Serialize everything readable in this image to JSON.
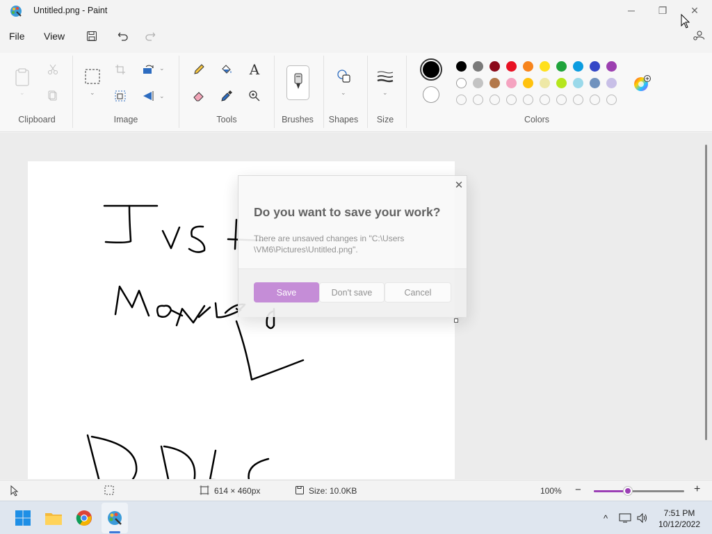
{
  "window": {
    "title": "Untitled.png - Paint",
    "minimize_glyph": "─",
    "maximize_glyph": "❐",
    "close_glyph": "✕"
  },
  "menu": {
    "file": "File",
    "view": "View"
  },
  "ribbon": {
    "groups": {
      "clipboard": "Clipboard",
      "image": "Image",
      "tools": "Tools",
      "brushes": "Brushes",
      "shapes": "Shapes",
      "size": "Size",
      "colors": "Colors"
    },
    "text_tool_glyph": "A"
  },
  "colors": {
    "primary": "#000000",
    "secondary": "#ffffff",
    "row1": [
      "#000000",
      "#7a7a7a",
      "#8b0a1a",
      "#e81123",
      "#f7841c",
      "#ffe01b",
      "#1fa33a",
      "#0b9ce0",
      "#3447c7",
      "#9c3fb0"
    ],
    "row2": [
      "#ffffff",
      "#c3c3c3",
      "#b3784a",
      "#f5a3c0",
      "#ffc20e",
      "#eee8a6",
      "#b5e61d",
      "#9ad9ea",
      "#7092be",
      "#c8bfe7"
    ],
    "row3_empty_count": 10,
    "accent": "#9b3fb5"
  },
  "canvas": {
    "handwriting_lines": [
      "Just",
      "Monika",
      "DDLC"
    ]
  },
  "dialog": {
    "title": "Do you want to save your work?",
    "message": "There are unsaved changes in \"C:\\Users \\VM6\\Pictures\\Untitled.png\".",
    "save": "Save",
    "dont_save": "Don't save",
    "cancel": "Cancel",
    "close_glyph": "✕"
  },
  "status": {
    "dimensions": "614 × 460px",
    "size": "Size: 10.0KB",
    "zoom": "100%",
    "zoom_out": "−",
    "zoom_in": "+",
    "zoom_slider_fraction": 0.38
  },
  "taskbar": {
    "time": "7:51 PM",
    "date": "10/12/2022",
    "tray_chevron": "^"
  }
}
